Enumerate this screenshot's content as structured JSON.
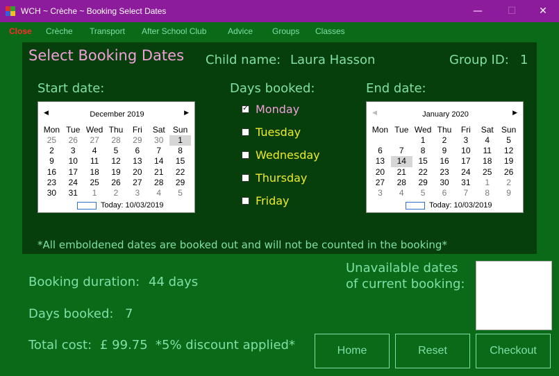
{
  "window": {
    "title": "WCH ~ Crèche ~ Booking Select Dates",
    "minimize": "—",
    "maximize": "☐",
    "close": "✕"
  },
  "menu": [
    "Close",
    "Crèche",
    "Transport",
    "After School Club",
    "Advice",
    "Groups",
    "Classes"
  ],
  "header": {
    "title": "Select Booking Dates",
    "child_label": "Child name:",
    "child_name": "Laura Hasson",
    "group_label": "Group ID:",
    "group_id": "1"
  },
  "labels": {
    "start": "Start date:",
    "days": "Days booked:",
    "end": "End date:",
    "note": "*All emboldened dates are booked out and will not be counted in the booking*"
  },
  "days": [
    {
      "label": "Monday",
      "checked": true
    },
    {
      "label": "Tuesday",
      "checked": false
    },
    {
      "label": "Wednesday",
      "checked": false
    },
    {
      "label": "Thursday",
      "checked": false
    },
    {
      "label": "Friday",
      "checked": false
    }
  ],
  "dow": [
    "Mon",
    "Tue",
    "Wed",
    "Thu",
    "Fri",
    "Sat",
    "Sun"
  ],
  "start_cal": {
    "month": "December 2019",
    "today": "Today: 10/03/2019",
    "selected": "1",
    "cells": [
      [
        "25",
        "o"
      ],
      [
        "26",
        "o"
      ],
      [
        "27",
        "o"
      ],
      [
        "28",
        "o"
      ],
      [
        "29",
        "o"
      ],
      [
        "30",
        "o"
      ],
      [
        "1",
        "s"
      ],
      [
        "2",
        ""
      ],
      [
        "3",
        ""
      ],
      [
        "4",
        ""
      ],
      [
        "5",
        ""
      ],
      [
        "6",
        ""
      ],
      [
        "7",
        ""
      ],
      [
        "8",
        ""
      ],
      [
        "9",
        ""
      ],
      [
        "10",
        ""
      ],
      [
        "11",
        ""
      ],
      [
        "12",
        ""
      ],
      [
        "13",
        ""
      ],
      [
        "14",
        ""
      ],
      [
        "15",
        ""
      ],
      [
        "16",
        ""
      ],
      [
        "17",
        ""
      ],
      [
        "18",
        ""
      ],
      [
        "19",
        ""
      ],
      [
        "20",
        ""
      ],
      [
        "21",
        ""
      ],
      [
        "22",
        ""
      ],
      [
        "23",
        ""
      ],
      [
        "24",
        ""
      ],
      [
        "25",
        ""
      ],
      [
        "26",
        ""
      ],
      [
        "27",
        ""
      ],
      [
        "28",
        ""
      ],
      [
        "29",
        ""
      ],
      [
        "30",
        ""
      ],
      [
        "31",
        ""
      ],
      [
        "1",
        "o"
      ],
      [
        "2",
        "o"
      ],
      [
        "3",
        "o"
      ],
      [
        "4",
        "o"
      ],
      [
        "5",
        "o"
      ]
    ]
  },
  "end_cal": {
    "month": "January 2020",
    "today": "Today: 10/03/2019",
    "selected": "14",
    "cells": [
      [
        "",
        "b"
      ],
      [
        "",
        "b"
      ],
      [
        "1",
        ""
      ],
      [
        "2",
        ""
      ],
      [
        "3",
        ""
      ],
      [
        "4",
        ""
      ],
      [
        "5",
        ""
      ],
      [
        "6",
        ""
      ],
      [
        "7",
        ""
      ],
      [
        "8",
        ""
      ],
      [
        "9",
        ""
      ],
      [
        "10",
        ""
      ],
      [
        "11",
        ""
      ],
      [
        "12",
        ""
      ],
      [
        "13",
        ""
      ],
      [
        "14",
        "s"
      ],
      [
        "15",
        ""
      ],
      [
        "16",
        ""
      ],
      [
        "17",
        ""
      ],
      [
        "18",
        ""
      ],
      [
        "19",
        ""
      ],
      [
        "20",
        ""
      ],
      [
        "21",
        ""
      ],
      [
        "22",
        ""
      ],
      [
        "23",
        ""
      ],
      [
        "24",
        ""
      ],
      [
        "25",
        ""
      ],
      [
        "26",
        ""
      ],
      [
        "27",
        ""
      ],
      [
        "28",
        ""
      ],
      [
        "29",
        ""
      ],
      [
        "30",
        ""
      ],
      [
        "31",
        ""
      ],
      [
        "1",
        "o"
      ],
      [
        "2",
        "o"
      ],
      [
        "3",
        "o"
      ],
      [
        "4",
        "o"
      ],
      [
        "5",
        "o"
      ],
      [
        "6",
        "o"
      ],
      [
        "7",
        "o"
      ],
      [
        "8",
        "o"
      ],
      [
        "9",
        "o"
      ]
    ]
  },
  "summary": {
    "duration_label": "Booking duration:",
    "duration": "44 days",
    "days_label": "Days booked:",
    "days": "7",
    "cost_label": "Total cost:",
    "cost": "£ 99.75",
    "discount": "*5% discount applied*",
    "unavailable_1": "Unavailable dates",
    "unavailable_2": "of current booking:"
  },
  "buttons": {
    "home": "Home",
    "reset": "Reset",
    "checkout": "Checkout"
  },
  "colors": {
    "titlebar": "#8d1c9c",
    "background": "#0a6a17",
    "panel": "#063e0c",
    "text": "#7fe0a8",
    "title": "#f0a0d8",
    "close_menu": "#ff2a2a"
  }
}
